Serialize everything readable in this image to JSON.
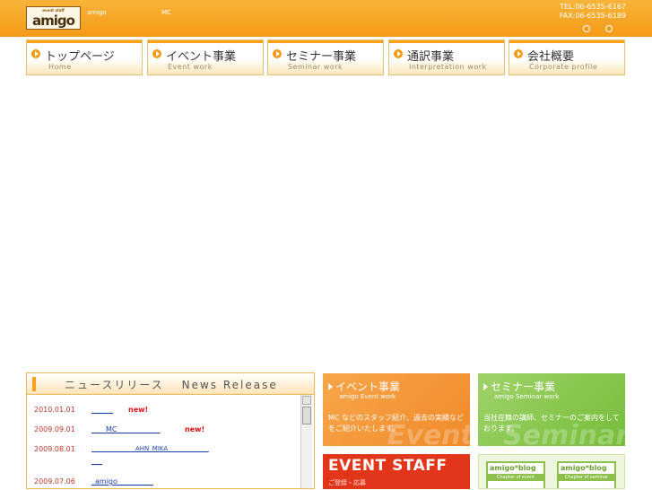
{
  "header": {
    "logo_text": "amigo",
    "logo_tagline": "event staff",
    "small_left": "amigo",
    "small_mid": "MC",
    "tel": "TEL:06-6535-6167",
    "fax": "FAX:06-6535-6189"
  },
  "nav": [
    {
      "jp": "トップページ",
      "en": "Home"
    },
    {
      "jp": "イベント事業",
      "en": "Event work"
    },
    {
      "jp": "セミナー事業",
      "en": "Seminar work"
    },
    {
      "jp": "通訳事業",
      "en": "Interpretation work"
    },
    {
      "jp": "会社概要",
      "en": "Corporate profile"
    }
  ],
  "news": {
    "title": "ニュースリリース　 News Release",
    "rows": [
      {
        "date": "2010.01.01",
        "link": "______",
        "new": "new!"
      },
      {
        "date": "2009.09.01",
        "link": "____MC____________",
        "new": "new!"
      },
      {
        "date": "2009.08.01",
        "link": "______________AHN_MIKA_____________",
        "link2": "___",
        "new": ""
      },
      {
        "date": "2009.07.06",
        "link": "_amigo__________",
        "new": ""
      }
    ]
  },
  "boxes": {
    "event": {
      "title": "イベント事業",
      "sub": "amigo Event work",
      "desc": "MC などのスタッフ紹介、過去の実績などをご紹介いたします。",
      "watermark": "Event"
    },
    "seminar": {
      "title": "セミナー事業",
      "sub": "amigo Seminar work",
      "desc": "当社在籍の講師、セミナーのご案内をしております。",
      "watermark": "Seminar"
    },
    "staff": {
      "title": "EVENT STAFF",
      "sub": "ご登録・応募"
    },
    "blog": {
      "cards": [
        {
          "title": "amigo*blog",
          "sub": "Chapter of event"
        },
        {
          "title": "amigo*blog",
          "sub": "Chapter of seminar"
        }
      ]
    }
  },
  "colors": {
    "header_orange": "#f59a18",
    "event_orange": "#f08a2a",
    "seminar_green": "#76bd3a",
    "staff_red": "#e2361a",
    "news_date": "#c0392b",
    "news_link": "#1a3fa8",
    "news_new": "#e01010"
  }
}
